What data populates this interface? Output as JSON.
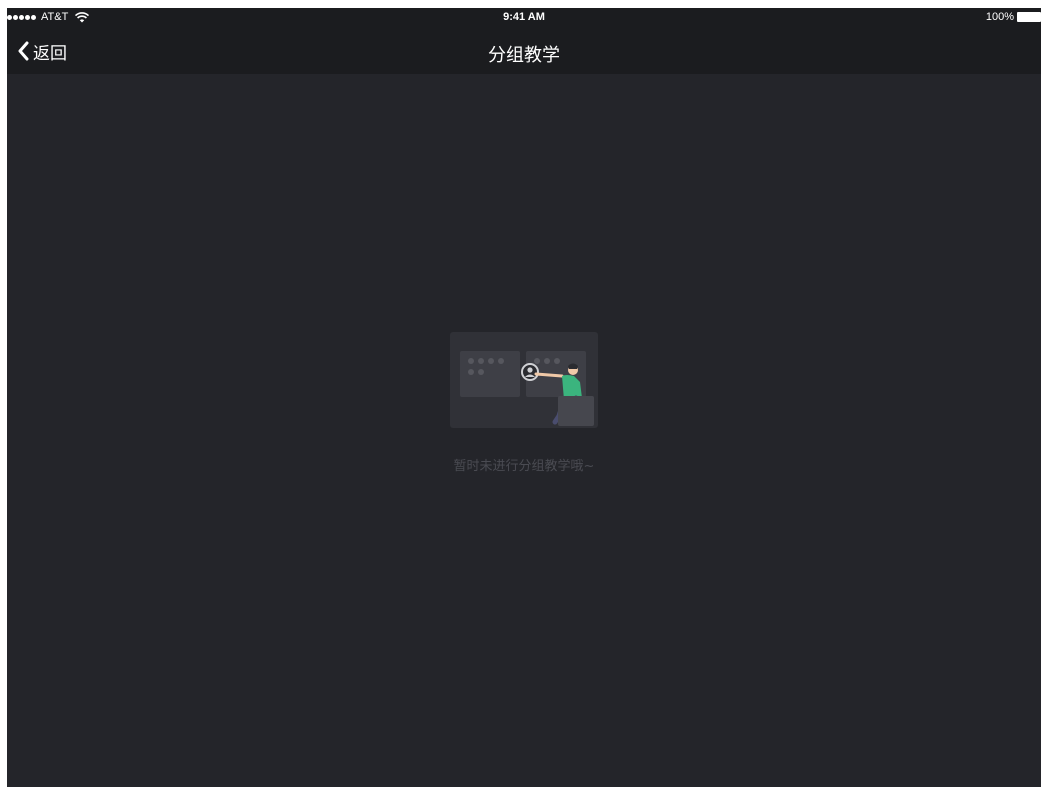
{
  "status_bar": {
    "carrier": "AT&T",
    "time": "9:41 AM",
    "battery": "100%"
  },
  "nav": {
    "back_label": "返回",
    "title": "分组教学"
  },
  "empty_state": {
    "message": "暂时未进行分组教学哦~",
    "illustration": "teacher-at-board-illustration"
  },
  "colors": {
    "background": "#24252a",
    "bar": "#1b1c1f",
    "accent": "#3bb47e",
    "muted_text": "#4a4b52"
  }
}
